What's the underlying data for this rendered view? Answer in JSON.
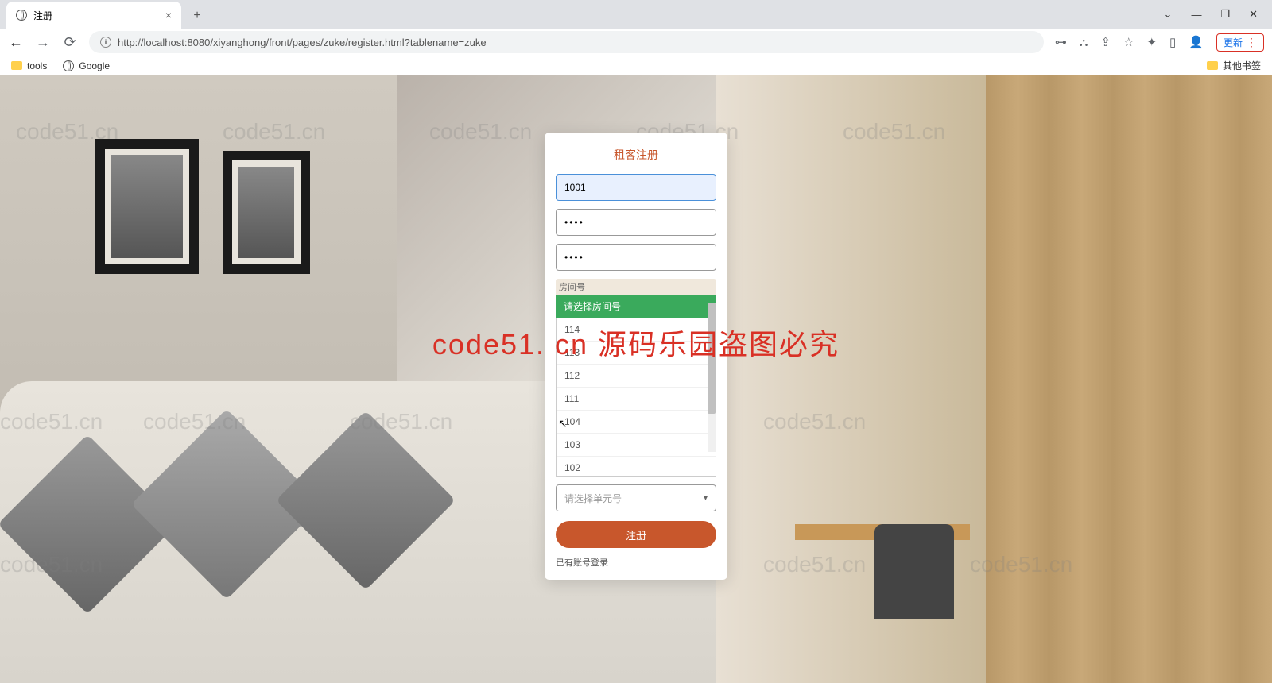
{
  "browser": {
    "tab_title": "注册",
    "url": "http://localhost:8080/xiyanghong/front/pages/zuke/register.html?tablename=zuke",
    "update_label": "更新",
    "bookmarks": {
      "tools": "tools",
      "google": "Google",
      "other": "其他书签"
    }
  },
  "watermark": {
    "text": "code51.cn",
    "red_text": "code51. cn 源码乐园盗图必究"
  },
  "form": {
    "title": "租客注册",
    "account_value": "1001",
    "password_value": "••••",
    "confirm_value": "••••",
    "dropdown_label": "房间号",
    "dropdown_selected": "请选择房间号",
    "dropdown_options": [
      "114",
      "113",
      "112",
      "111",
      "104",
      "103",
      "102"
    ],
    "unit_placeholder": "请选择单元号",
    "submit_label": "注册",
    "login_link": "已有账号登录"
  }
}
